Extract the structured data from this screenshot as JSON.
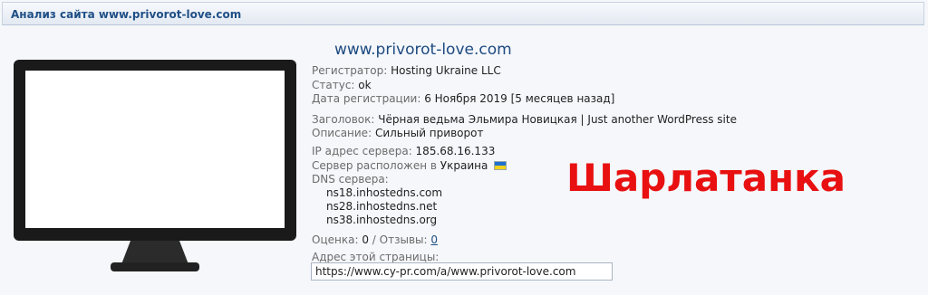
{
  "header": {
    "title": "Анализ сайта www.privorot-love.com"
  },
  "site": {
    "domain": "www.privorot-love.com",
    "registrar_label": "Регистратор:",
    "registrar_value": "Hosting Ukraine LLC",
    "status_label": "Статус:",
    "status_value": "ok",
    "regdate_label": "Дата регистрации:",
    "regdate_value": "6 Ноября 2019 [5 месяцев назад]",
    "heading_label": "Заголовок:",
    "heading_value": "Чёрная ведьма Эльмира Новицкая | Just another WordPress site",
    "description_label": "Описание:",
    "description_value": "Сильный приворот",
    "ip_label": "IP адрес сервера:",
    "ip_value": "185.68.16.133",
    "location_label": "Сервер расположен в",
    "location_value": "Украина",
    "dns_label": "DNS сервера:",
    "dns": [
      "ns18.inhostedns.com",
      "ns28.inhostedns.net",
      "ns38.inhostedns.org"
    ],
    "rating_label": "Оценка:",
    "rating_value": "0",
    "separator": "/",
    "reviews_label": "Отзывы:",
    "reviews_value": "0",
    "page_address_label": "Адрес этой страницы:",
    "page_address_value": "https://www.cy-pr.com/a/www.privorot-love.com"
  },
  "overlay": {
    "stamp_text": "Шарлатанка"
  },
  "colors": {
    "stamp": "#e81010",
    "link": "#1f4f86",
    "header_text": "#1f4f86"
  }
}
